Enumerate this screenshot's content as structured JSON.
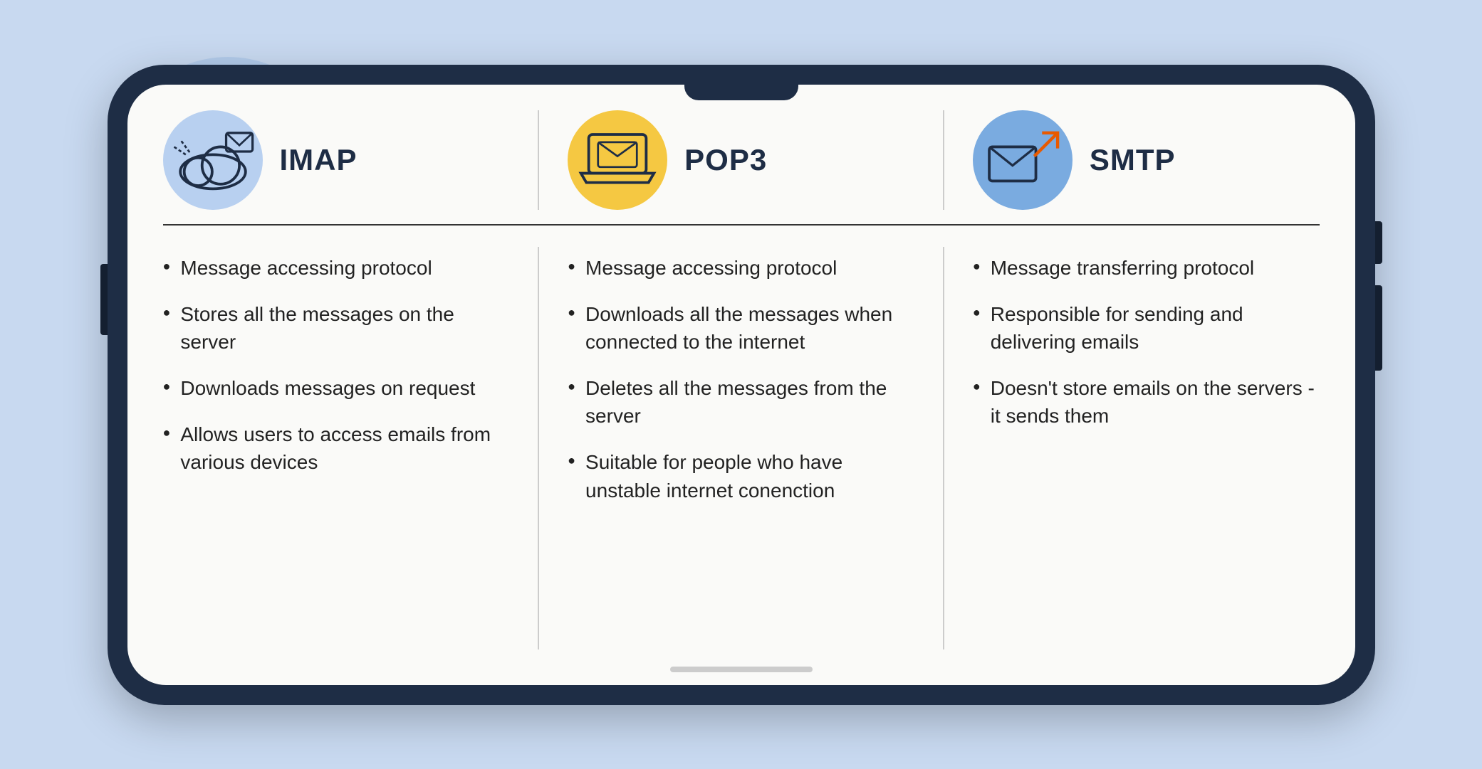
{
  "background": {
    "color": "#c8d9f0"
  },
  "columns": [
    {
      "id": "imap",
      "title": "IMAP",
      "icon_bg": "blue",
      "icon_type": "cloud-email",
      "features": [
        "Message accessing protocol",
        "Stores all the messages on the server",
        "Downloads messages on request",
        "Allows users to access emails from various devices"
      ]
    },
    {
      "id": "pop3",
      "title": "POP3",
      "icon_bg": "orange",
      "icon_type": "laptop-email",
      "features": [
        "Message accessing protocol",
        "Downloads all the messages when connected to the internet",
        "Deletes all the messages from the server",
        "Suitable for people who have unstable internet conenction"
      ]
    },
    {
      "id": "smtp",
      "title": "SMTP",
      "icon_bg": "blue-dark",
      "icon_type": "email-arrow",
      "features": [
        "Message transferring protocol",
        "Responsible for sending and delivering emails",
        "Doesn't store emails on the servers - it sends them"
      ]
    }
  ]
}
